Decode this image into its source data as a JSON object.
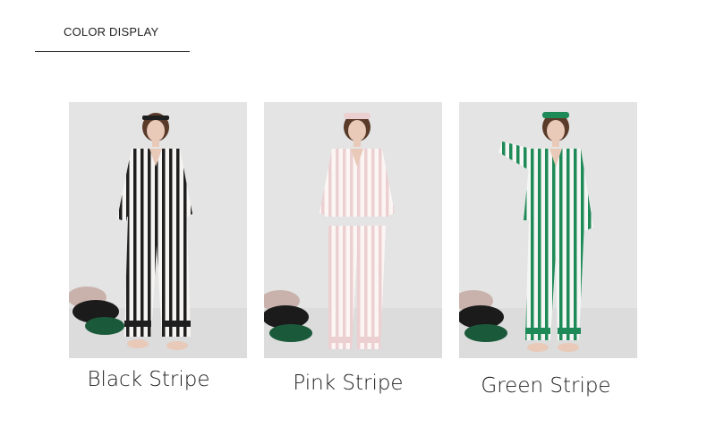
{
  "section": {
    "title": "COLOR DISPLAY"
  },
  "products": [
    {
      "caption": "Black Stripe",
      "stripe_color": "#1f1f1f",
      "accent": "#b9a7a0"
    },
    {
      "caption": "Pink Stripe",
      "stripe_color": "#e8c6c8",
      "accent": "#e8c6c8"
    },
    {
      "caption": "Green Stripe",
      "stripe_color": "#1e8a58",
      "accent": "#1e8a58"
    }
  ],
  "colors": {
    "photo_background": "#e4e4e4",
    "floor": "#dcdcdc",
    "fabric_base": "#f6f4f3",
    "skin": "#e9c9b8",
    "hair": "#5a3b2a"
  }
}
